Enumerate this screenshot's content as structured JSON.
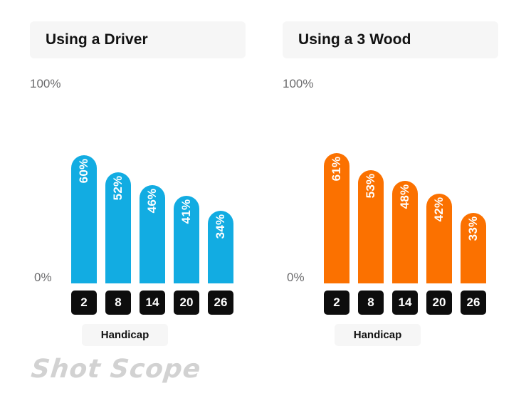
{
  "chart_data": [
    {
      "type": "bar",
      "title": "Using a Driver",
      "xlabel": "Handicap",
      "ylabel": "",
      "categories": [
        "2",
        "8",
        "14",
        "20",
        "26"
      ],
      "values": [
        60,
        52,
        46,
        41,
        34
      ],
      "value_labels": [
        "60%",
        "52%",
        "46%",
        "41%",
        "34%"
      ],
      "ylim": [
        0,
        100
      ],
      "ytick_labels": [
        "100%",
        "0%"
      ],
      "grid": false,
      "legend": "none",
      "bar_color": "#12ace2"
    },
    {
      "type": "bar",
      "title": "Using a 3 Wood",
      "xlabel": "Handicap",
      "ylabel": "",
      "categories": [
        "2",
        "8",
        "14",
        "20",
        "26"
      ],
      "values": [
        61,
        53,
        48,
        42,
        33
      ],
      "value_labels": [
        "61%",
        "53%",
        "48%",
        "42%",
        "33%"
      ],
      "ylim": [
        0,
        100
      ],
      "ytick_labels": [
        "100%",
        "0%"
      ],
      "grid": false,
      "legend": "none",
      "bar_color": "#fb7100"
    }
  ],
  "panels": [
    {
      "title": "Using a Driver",
      "axis_top": "100%",
      "axis_zero": "0%",
      "axis_name": "Handicap",
      "bars": [
        {
          "label": "60%",
          "tick": "2"
        },
        {
          "label": "52%",
          "tick": "8"
        },
        {
          "label": "46%",
          "tick": "14"
        },
        {
          "label": "41%",
          "tick": "20"
        },
        {
          "label": "34%",
          "tick": "26"
        }
      ]
    },
    {
      "title": "Using a 3 Wood",
      "axis_top": "100%",
      "axis_zero": "0%",
      "axis_name": "Handicap",
      "bars": [
        {
          "label": "61%",
          "tick": "2"
        },
        {
          "label": "53%",
          "tick": "8"
        },
        {
          "label": "48%",
          "tick": "14"
        },
        {
          "label": "42%",
          "tick": "20"
        },
        {
          "label": "33%",
          "tick": "26"
        }
      ]
    }
  ],
  "watermark": {
    "text": "Shot Scope"
  },
  "colors": {
    "blue": "#12ace2",
    "orange": "#fb7100",
    "chip": "#0d0d0d",
    "pill_bg": "#f6f6f6",
    "axis_text": "#6b6b6d",
    "watermark": "#d2d2d2"
  }
}
